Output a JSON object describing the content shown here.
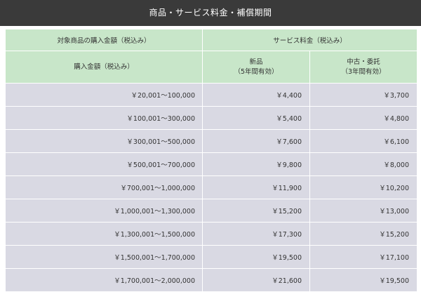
{
  "title": "商品・サービス料金・補償期間",
  "header": {
    "left_top": "対象商品の購入金額（税込み）",
    "right_top": "サービス料金（税込み）",
    "left_sub": "購入金額（税込み）",
    "col_new_label": "新品",
    "col_new_period": "（5年間有効）",
    "col_used_label": "中古・委託",
    "col_used_period": "（3年間有効）"
  },
  "rows": [
    {
      "range": "￥20,001～100,000",
      "new": "￥4,400",
      "used": "￥3,700"
    },
    {
      "range": "￥100,001～300,000",
      "new": "￥5,400",
      "used": "￥4,800"
    },
    {
      "range": "￥300,001～500,000",
      "new": "￥7,600",
      "used": "￥6,100"
    },
    {
      "range": "￥500,001～700,000",
      "new": "￥9,800",
      "used": "￥8,000"
    },
    {
      "range": "￥700,001～1,000,000",
      "new": "￥11,900",
      "used": "￥10,200"
    },
    {
      "range": "￥1,000,001～1,300,000",
      "new": "￥15,200",
      "used": "￥13,000"
    },
    {
      "range": "￥1,300,001～1,500,000",
      "new": "￥17,300",
      "used": "￥15,200"
    },
    {
      "range": "￥1,500,001～1,700,000",
      "new": "￥19,500",
      "used": "￥17,100"
    },
    {
      "range": "￥1,700,001～2,000,000",
      "new": "￥21,600",
      "used": "￥19,500"
    }
  ],
  "colors": {
    "title_bg": "#3a3a3a",
    "header_bg": "#c8e6c9",
    "cell_bg": "#d9d9e3"
  }
}
